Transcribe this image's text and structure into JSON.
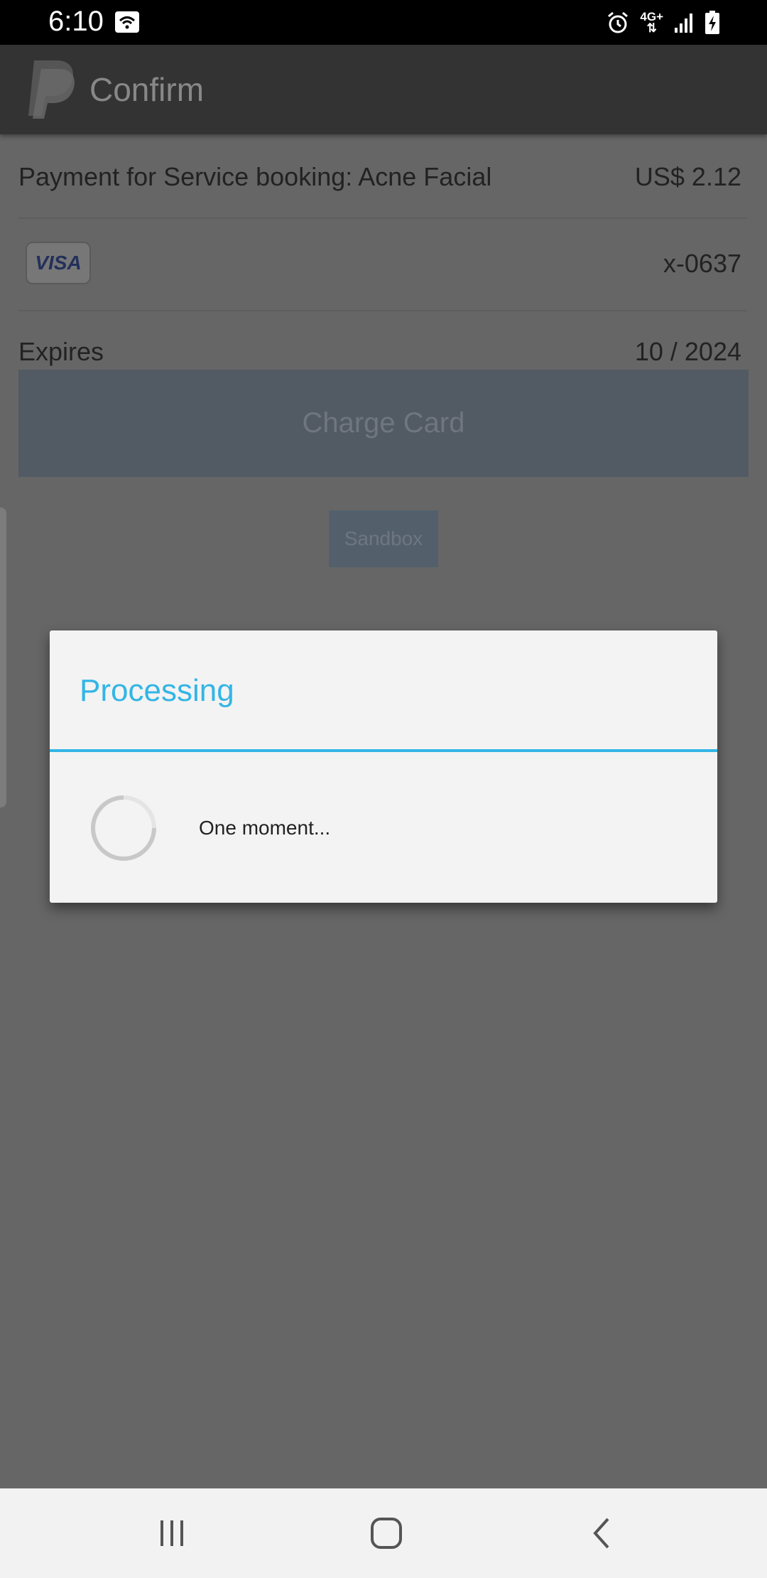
{
  "status_bar": {
    "time": "6:10",
    "network": "4G+",
    "icons": [
      "wifi-icon",
      "alarm-icon",
      "network-4g-icon",
      "signal-icon",
      "battery-charging-icon"
    ]
  },
  "app_bar": {
    "title": "Confirm",
    "logo": "paypal-logo"
  },
  "payment": {
    "description": "Payment for Service booking: Acne Facial",
    "amount": "US$ 2.12",
    "card_brand": "VISA",
    "card_number": "x-0637",
    "expires_label": "Expires",
    "expires_value": "10 / 2024"
  },
  "actions": {
    "charge_card": "Charge Card",
    "sandbox": "Sandbox"
  },
  "dialog": {
    "title": "Processing",
    "message": "One moment..."
  },
  "colors": {
    "accent": "#33b5e5",
    "overlay": "#666666",
    "status_bar": "#000000",
    "nav_bar": "#f2f2f2"
  },
  "nav_bar": {
    "buttons": [
      "recents-icon",
      "home-icon",
      "back-icon"
    ]
  }
}
